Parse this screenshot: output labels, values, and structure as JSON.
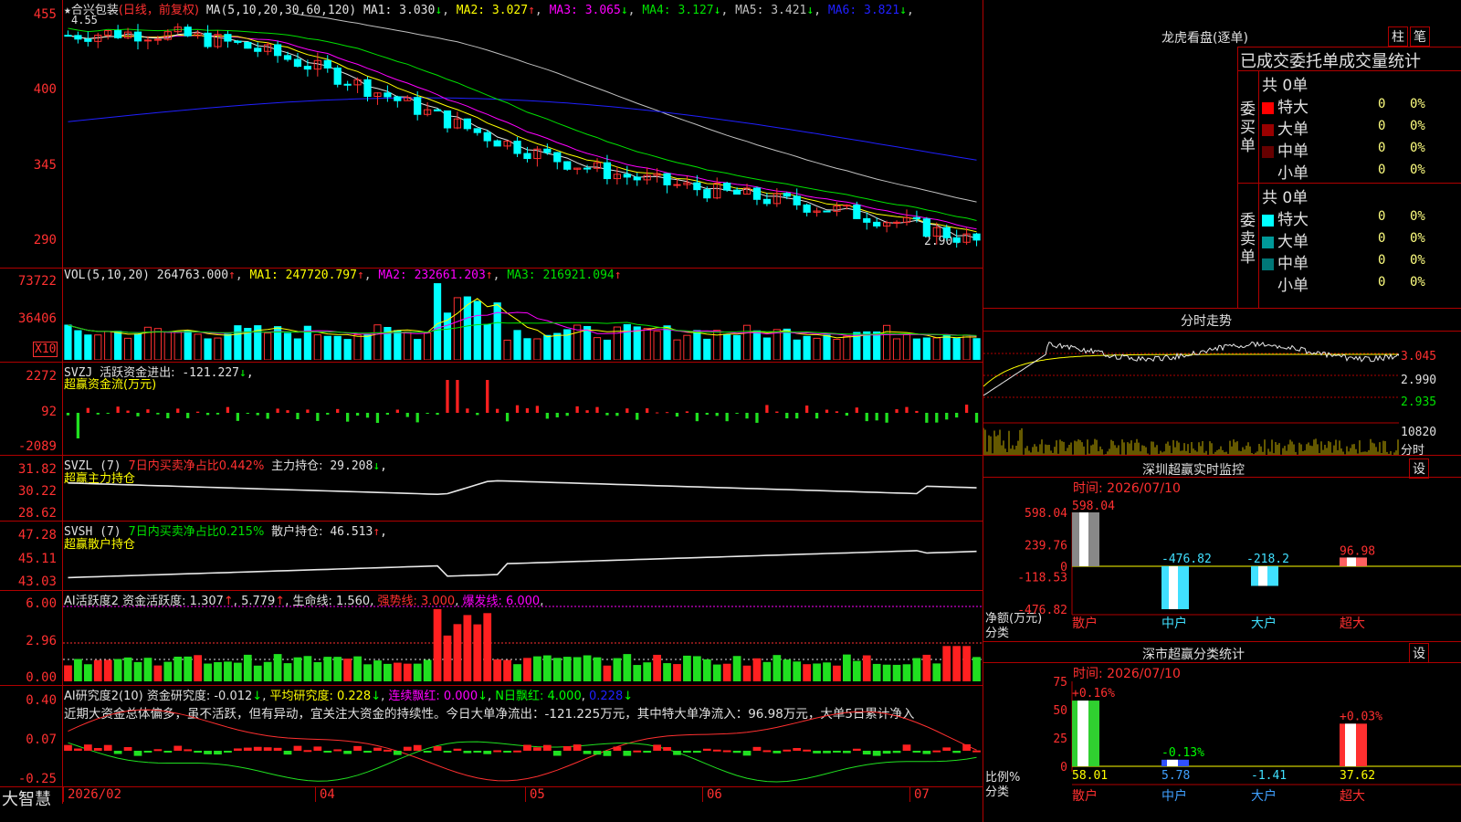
{
  "main": {
    "stock_name": "合兴包装",
    "mode": "(日线，前复权)",
    "ma_label": "MA(5,10,20,30,60,120)",
    "ma": [
      {
        "name": "MA1",
        "value": "3.030",
        "arrow": "↓",
        "color": "#e0e0e0"
      },
      {
        "name": "MA2",
        "value": "3.027",
        "arrow": "↑",
        "color": "#ffff00"
      },
      {
        "name": "MA3",
        "value": "3.065",
        "arrow": "↓",
        "color": "#ff00ff"
      },
      {
        "name": "MA4",
        "value": "3.127",
        "arrow": "↓",
        "color": "#00e000"
      },
      {
        "name": "MA5",
        "value": "3.421",
        "arrow": "↓",
        "color": "#c0c0c0"
      },
      {
        "name": "MA6",
        "value": "3.821",
        "arrow": "↓",
        "color": "#2020ff"
      }
    ],
    "high_mark": "4.55",
    "low_mark": "2.90",
    "y_labels": [
      "455",
      "400",
      "345",
      "290"
    ],
    "colors": {
      "up": "#ff3030",
      "down": "#00ffff",
      "ma1": "#e0e0e0",
      "ma2": "#ffff00",
      "ma3": "#ff00ff",
      "ma4": "#00e000",
      "ma5": "#c0c0c0",
      "ma6": "#2020ff"
    }
  },
  "vol": {
    "label": "VOL(5,10,20)",
    "value": "264763.000",
    "ma1": "247720.797",
    "ma2": "232661.203",
    "ma3": "216921.094",
    "y_labels": [
      "73722",
      "36406"
    ],
    "unit": "X10"
  },
  "svzj": {
    "label": "SVZJ",
    "title": "活跃资金进出:",
    "value": "-121.227",
    "subtitle": "超赢资金流(万元)",
    "y_labels": [
      "2272",
      "92",
      "-2089"
    ]
  },
  "svzl": {
    "label": "SVZL (7)",
    "stat": "7日内买卖净占比0.442%",
    "hold": "主力持仓:",
    "hold_value": "29.208",
    "subtitle": "超赢主力持仓",
    "y_labels": [
      "31.82",
      "30.22",
      "28.62"
    ]
  },
  "svsh": {
    "label": "SVSH (7)",
    "stat": "7日内买卖净占比0.215%",
    "hold": "散户持仓:",
    "hold_value": "46.513",
    "subtitle": "超赢散户持仓",
    "y_labels": [
      "47.28",
      "45.11",
      "43.03"
    ]
  },
  "ai_active": {
    "label": "AI活跃度2",
    "item1": "资金活跃度:",
    "v1": "1.307",
    "v2": "5.779",
    "item2": "生命线:",
    "v3": "1.560",
    "strong": "强势线: 3.000",
    "burst": "爆发线: 6.000",
    "y_labels": [
      "6.00",
      "2.96",
      "0.00"
    ]
  },
  "ai_research": {
    "label": "AI研究度2(10)",
    "item1": "资金研究度:",
    "v1": "-0.012",
    "avg": "平均研究度: 0.228",
    "cont": "连续飘红: 0.000",
    "nday": "N日飘红: 4.000",
    "v5": "0.228",
    "comment": "近期大资金总体偏多，虽不活跃，但有异动，宜关注大资金的持续性。今日大单净流出：-121.225万元，其中特大单净流入：96.98万元，大单5日累计净入",
    "y_labels": [
      "0.40",
      "0.07",
      "-0.25"
    ]
  },
  "bottom": {
    "app_name": "大智慧",
    "dates": [
      "2026/02",
      "04",
      "05",
      "06",
      "07"
    ]
  },
  "right": {
    "dragon_title": "龙虎看盘(逐单)",
    "btn_col": "柱",
    "btn_line": "笔",
    "order_header": "已成交委托单成交量统计",
    "buy_label": "委买单",
    "sell_label": "委卖单",
    "buy_total": "共 0单",
    "sell_total": "共 0单",
    "buy_rows": [
      {
        "name": "特大",
        "count": "0",
        "pct": "0%",
        "color": "#ff0000"
      },
      {
        "name": "大单",
        "count": "0",
        "pct": "0%",
        "color": "#990000"
      },
      {
        "name": "中单",
        "count": "0",
        "pct": "0%",
        "color": "#660000"
      },
      {
        "name": "小单",
        "count": "0",
        "pct": "0%",
        "color": "#000000"
      }
    ],
    "sell_rows": [
      {
        "name": "特大",
        "count": "0",
        "pct": "0%",
        "color": "#00ffff"
      },
      {
        "name": "大单",
        "count": "0",
        "pct": "0%",
        "color": "#009999"
      },
      {
        "name": "中单",
        "count": "0",
        "pct": "0%",
        "color": "#007777"
      },
      {
        "name": "小单",
        "count": "0",
        "pct": "0%",
        "color": "#000000"
      }
    ],
    "intraday_title": "分时走势",
    "intraday_prices": [
      "3.045",
      "2.990",
      "2.935"
    ],
    "intraday_vol": "10820",
    "intraday_unit": "分时",
    "monitor_title": "深圳超赢实时监控",
    "monitor_btn": "设",
    "monitor_time": "时间: 2026/07/10",
    "monitor_ylabels": [
      "598.04",
      "239.76",
      "0",
      "-118.53",
      "-476.82"
    ],
    "monitor_axis_label": "净额(万元)",
    "monitor_cat_label": "分类",
    "stats_title": "深市超赢分类统计",
    "stats_btn": "设",
    "stats_time": "时间: 2026/07/10",
    "stats_ylabels": [
      "75",
      "50",
      "25",
      "0"
    ],
    "stats_axis_label": "比例%",
    "stats_cat_label": "分类"
  },
  "chart_data": [
    {
      "type": "bar",
      "title": "深圳超赢实时监控",
      "ylabel": "净额(万元)",
      "categories": [
        "散户",
        "中户",
        "大户",
        "超大"
      ],
      "values": [
        598.04,
        -476.82,
        -218.2,
        96.98
      ],
      "ylim": [
        -476.82,
        598.04
      ]
    },
    {
      "type": "bar",
      "title": "深市超赢分类统计",
      "ylabel": "比例%",
      "categories": [
        "散户",
        "中户",
        "大户",
        "超大"
      ],
      "values": [
        58.01,
        5.78,
        -1.41,
        37.62
      ],
      "changes": [
        "+0.16%",
        "-0.13%",
        "",
        "+0.03%"
      ],
      "ylim": [
        0,
        75
      ]
    }
  ]
}
